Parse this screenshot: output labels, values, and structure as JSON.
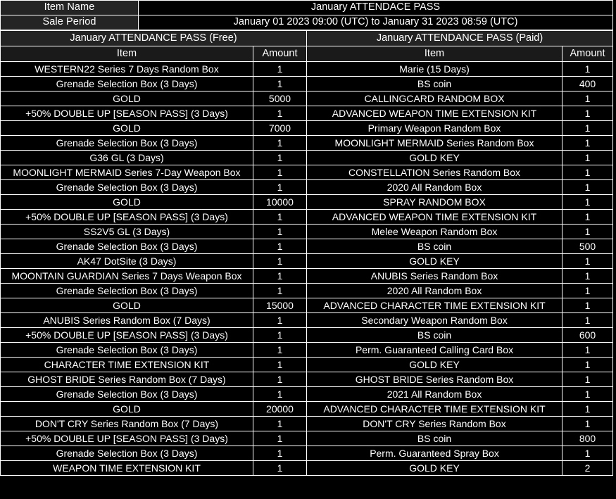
{
  "meta": {
    "item_name_label": "Item Name",
    "item_name_value": "January ATTENDACE PASS",
    "sale_period_label": "Sale Period",
    "sale_period_value": "January 01 2023 09:00 (UTC) to January 31 2023 08:59 (UTC)"
  },
  "sections": {
    "free_title": "January ATTENDANCE PASS (Free)",
    "paid_title": "January ATTENDANCE PASS (Paid)"
  },
  "columns": {
    "item": "Item",
    "amount": "Amount"
  },
  "rows": [
    {
      "free_item": "WESTERN22 Series 7 Days Random Box",
      "free_amount": "1",
      "paid_item": "Marie (15 Days)",
      "paid_amount": "1"
    },
    {
      "free_item": "Grenade Selection Box (3 Days)",
      "free_amount": "1",
      "paid_item": "BS coin",
      "paid_amount": "400"
    },
    {
      "free_item": "GOLD",
      "free_amount": "5000",
      "paid_item": "CALLINGCARD RANDOM BOX",
      "paid_amount": "1"
    },
    {
      "free_item": "+50% DOUBLE UP [SEASON PASS] (3 Days)",
      "free_amount": "1",
      "paid_item": "ADVANCED WEAPON TIME EXTENSION KIT",
      "paid_amount": "1"
    },
    {
      "free_item": "GOLD",
      "free_amount": "7000",
      "paid_item": "Primary Weapon Random Box",
      "paid_amount": "1"
    },
    {
      "free_item": "Grenade Selection Box (3 Days)",
      "free_amount": "1",
      "paid_item": "MOONLIGHT MERMAID Series Random Box",
      "paid_amount": "1"
    },
    {
      "free_item": "G36 GL (3 Days)",
      "free_amount": "1",
      "paid_item": "GOLD KEY",
      "paid_amount": "1"
    },
    {
      "free_item": "MOONLIGHT MERMAID Series 7-Day Weapon Box",
      "free_amount": "1",
      "paid_item": "CONSTELLATION Series Random Box",
      "paid_amount": "1"
    },
    {
      "free_item": "Grenade Selection Box (3 Days)",
      "free_amount": "1",
      "paid_item": "2020 All Random Box",
      "paid_amount": "1"
    },
    {
      "free_item": "GOLD",
      "free_amount": "10000",
      "paid_item": "SPRAY RANDOM BOX",
      "paid_amount": "1"
    },
    {
      "free_item": "+50% DOUBLE UP [SEASON PASS] (3 Days)",
      "free_amount": "1",
      "paid_item": "ADVANCED WEAPON TIME EXTENSION KIT",
      "paid_amount": "1"
    },
    {
      "free_item": "SS2V5 GL (3 Days)",
      "free_amount": "1",
      "paid_item": "Melee Weapon Random Box",
      "paid_amount": "1"
    },
    {
      "free_item": "Grenade Selection Box (3 Days)",
      "free_amount": "1",
      "paid_item": "BS coin",
      "paid_amount": "500"
    },
    {
      "free_item": "AK47 DotSite (3 Days)",
      "free_amount": "1",
      "paid_item": "GOLD KEY",
      "paid_amount": "1"
    },
    {
      "free_item": "MOONTAIN GUARDIAN Series 7 Days Weapon Box",
      "free_amount": "1",
      "paid_item": "ANUBIS Series Random Box",
      "paid_amount": "1"
    },
    {
      "free_item": "Grenade Selection Box (3 Days)",
      "free_amount": "1",
      "paid_item": "2020 All Random Box",
      "paid_amount": "1"
    },
    {
      "free_item": "GOLD",
      "free_amount": "15000",
      "paid_item": "ADVANCED CHARACTER TIME EXTENSION KIT",
      "paid_amount": "1"
    },
    {
      "free_item": "ANUBIS Series Random Box (7 Days)",
      "free_amount": "1",
      "paid_item": "Secondary Weapon Random Box",
      "paid_amount": "1"
    },
    {
      "free_item": "+50% DOUBLE UP [SEASON PASS] (3 Days)",
      "free_amount": "1",
      "paid_item": "BS coin",
      "paid_amount": "600"
    },
    {
      "free_item": "Grenade Selection Box (3 Days)",
      "free_amount": "1",
      "paid_item": "Perm. Guaranteed Calling Card Box",
      "paid_amount": "1"
    },
    {
      "free_item": "CHARACTER TIME EXTENSION KIT",
      "free_amount": "1",
      "paid_item": "GOLD KEY",
      "paid_amount": "1"
    },
    {
      "free_item": "GHOST BRIDE Series Random Box (7 Days)",
      "free_amount": "1",
      "paid_item": "GHOST BRIDE Series Random Box",
      "paid_amount": "1"
    },
    {
      "free_item": "Grenade Selection Box (3 Days)",
      "free_amount": "1",
      "paid_item": "2021 All Random Box",
      "paid_amount": "1"
    },
    {
      "free_item": "GOLD",
      "free_amount": "20000",
      "paid_item": "ADVANCED CHARACTER TIME EXTENSION KIT",
      "paid_amount": "1"
    },
    {
      "free_item": "DON'T CRY Series Random Box (7 Days)",
      "free_amount": "1",
      "paid_item": "DON'T CRY Series Random Box",
      "paid_amount": "1"
    },
    {
      "free_item": "+50% DOUBLE UP [SEASON PASS] (3 Days)",
      "free_amount": "1",
      "paid_item": "BS coin",
      "paid_amount": "800"
    },
    {
      "free_item": "Grenade Selection Box (3 Days)",
      "free_amount": "1",
      "paid_item": "Perm. Guaranteed Spray Box",
      "paid_amount": "1"
    },
    {
      "free_item": "WEAPON TIME EXTENSION KIT",
      "free_amount": "1",
      "paid_item": "GOLD KEY",
      "paid_amount": "2"
    }
  ]
}
